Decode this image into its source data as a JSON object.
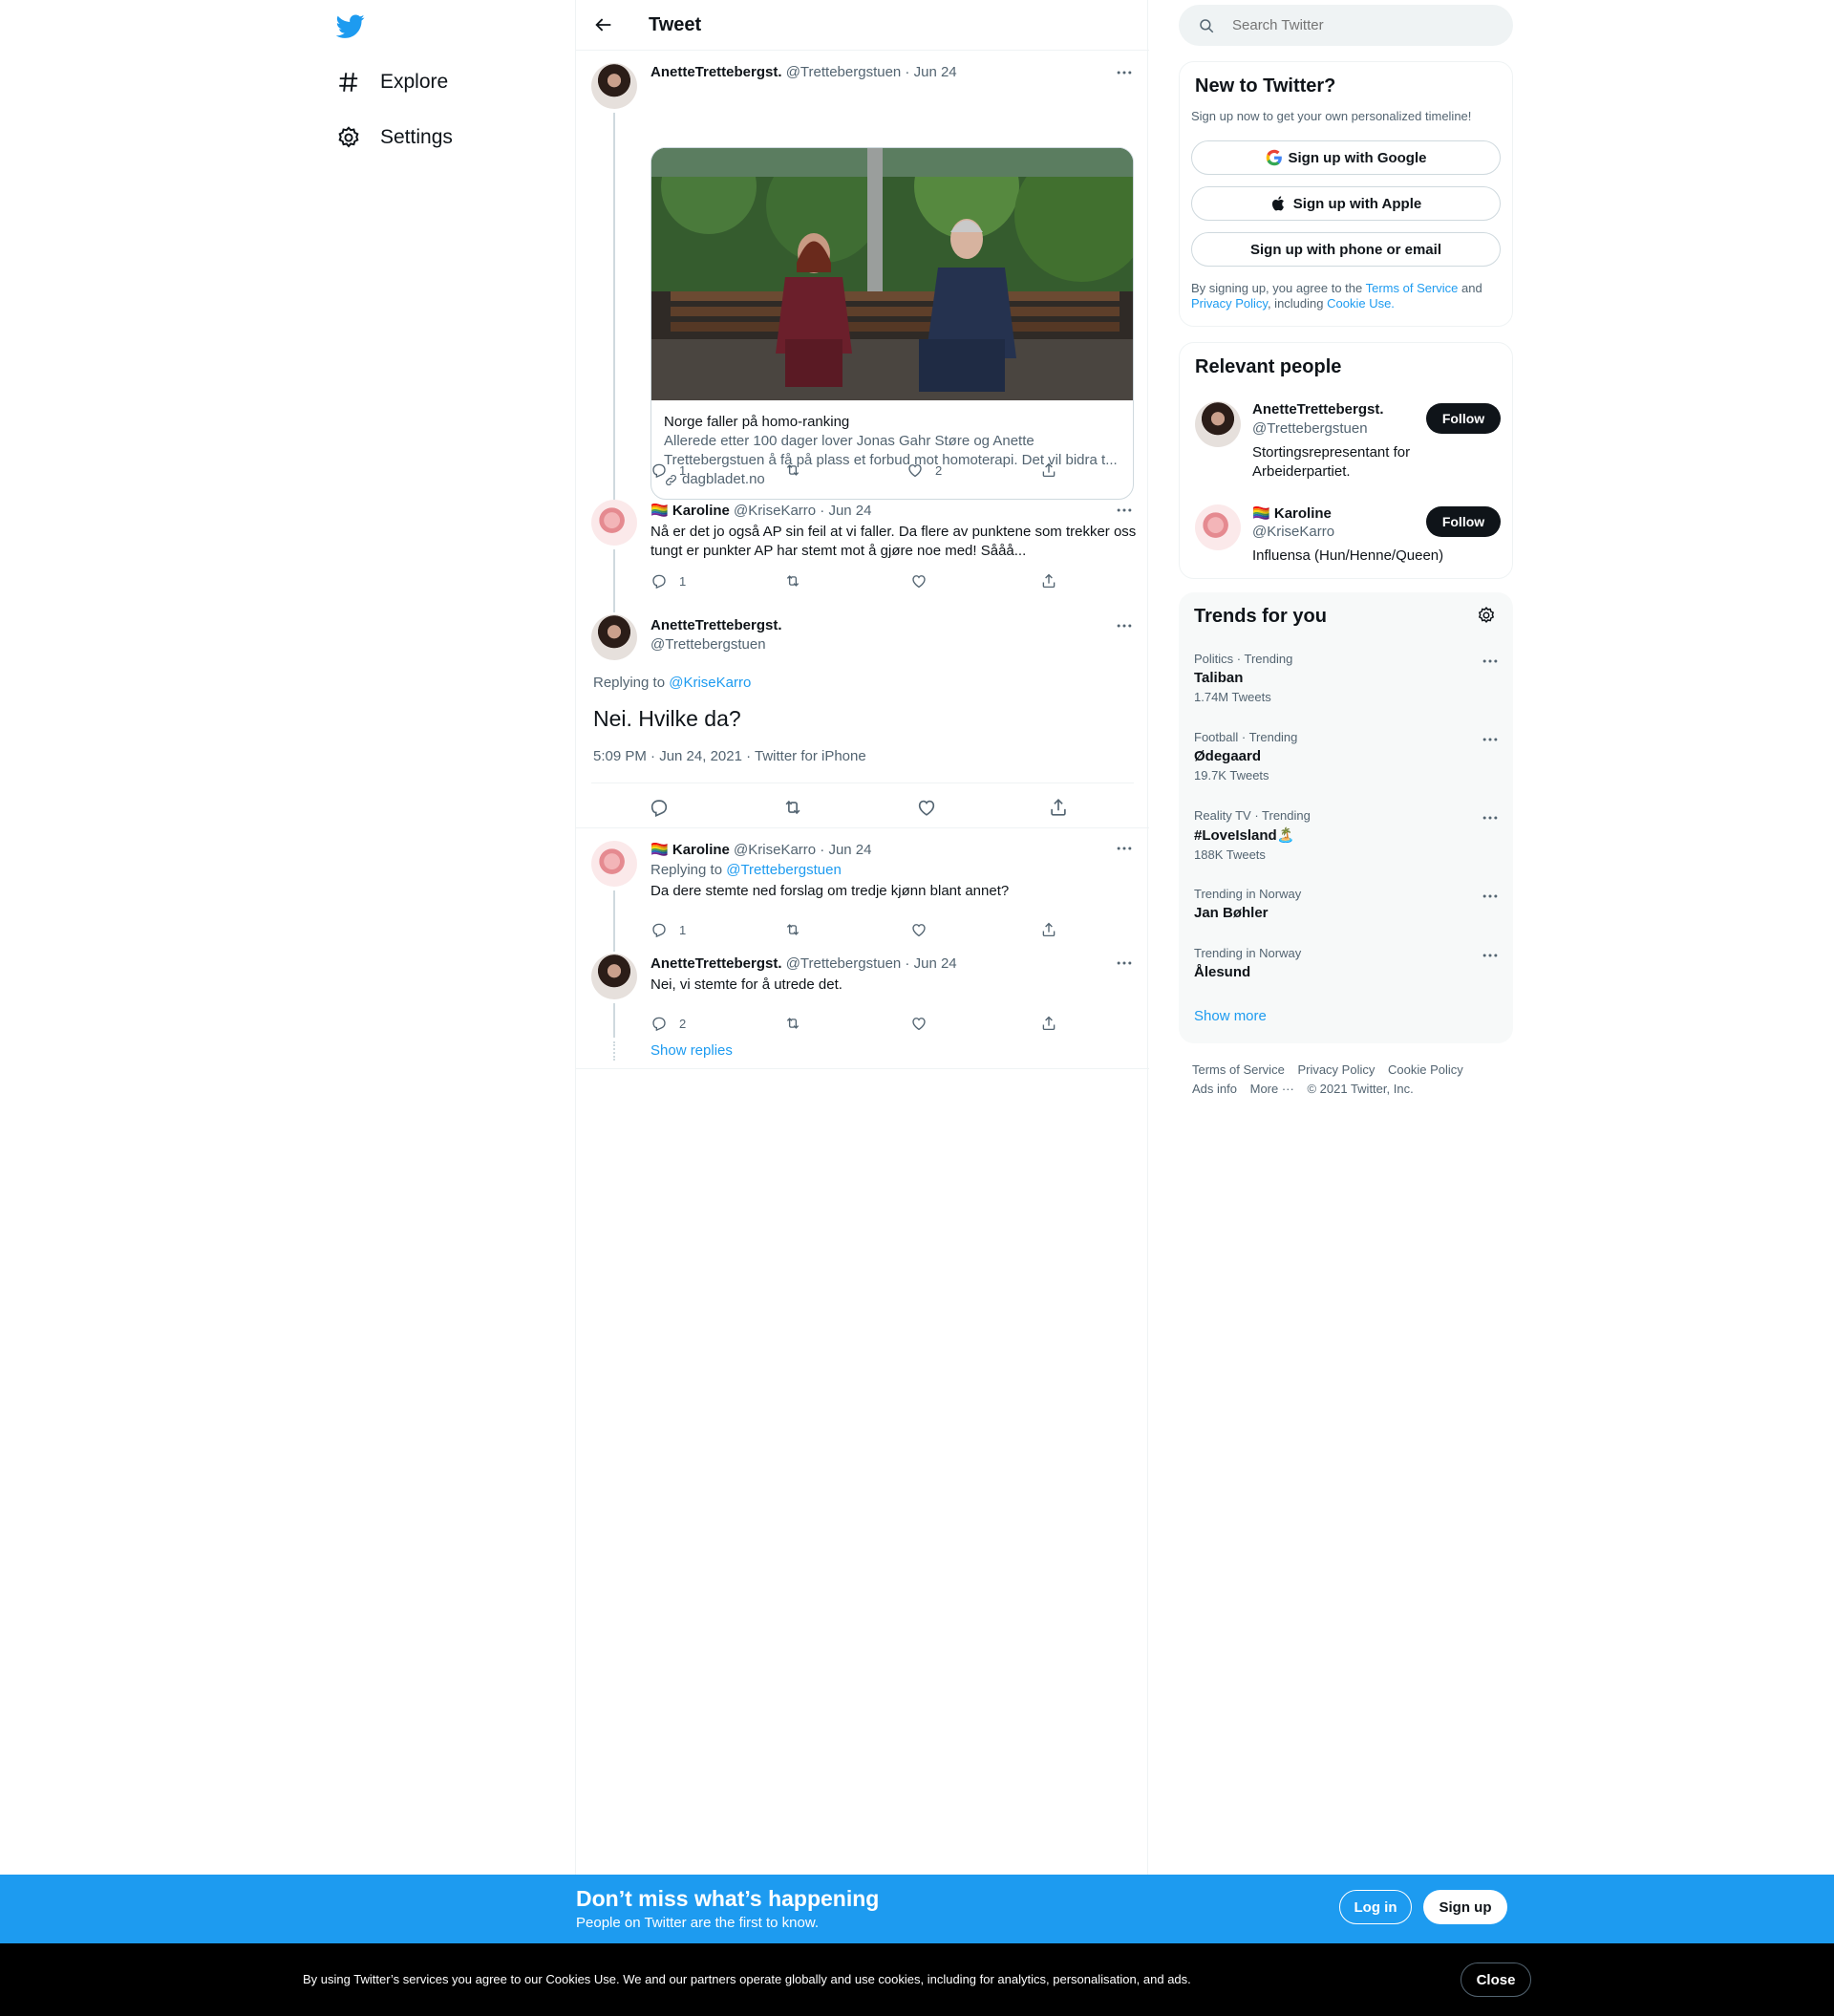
{
  "nav": {
    "explore": "Explore",
    "settings": "Settings"
  },
  "header": {
    "title": "Tweet"
  },
  "tweets": [
    {
      "name": "AnetteTrettebergst.",
      "meta": "@Trettebergstuen · Jun 24",
      "card": {
        "title": "Norge faller på homo-ranking",
        "description": "Allerede etter 100 dager lover Jonas Gahr Støre og Anette Trettebergstuen å få på plass et forbud mot homoterapi. Det vil bidra t...",
        "domain": "dagbladet.no"
      },
      "replies": "1",
      "likes": "2"
    },
    {
      "flag": "🏳️‍🌈",
      "name": "Karoline",
      "meta": "@KriseKarro · Jun 24",
      "text": "Nå er det jo også AP sin feil at vi faller. Da flere av punktene som trekker oss tungt er punkter AP har stemt mot å gjøre noe med! Sååå...",
      "replies": "1"
    }
  ],
  "focus": {
    "name": "AnetteTrettebergst.",
    "handle": "@Trettebergstuen",
    "replying_prefix": "Replying to ",
    "replying_to": "@KriseKarro",
    "text": "Nei. Hvilke da?",
    "meta": "5:09 PM · Jun 24, 2021 · Twitter for iPhone"
  },
  "replies": [
    {
      "flag": "🏳️‍🌈",
      "name": "Karoline",
      "meta": "@KriseKarro · Jun 24",
      "replying_prefix": "Replying to ",
      "replying_to": "@Trettebergstuen",
      "text": "Da dere stemte ned forslag om tredje kjønn blant annet?",
      "replies": "1"
    },
    {
      "name": "AnetteTrettebergst.",
      "meta": "@Trettebergstuen · Jun 24",
      "text": "Nei, vi stemte for å utrede det.",
      "replies": "2"
    }
  ],
  "show_replies": "Show replies",
  "sidebar": {
    "search_placeholder": "Search Twitter",
    "new": {
      "title": "New to Twitter?",
      "subtitle": "Sign up now to get your own personalized timeline!",
      "google": "Sign up with Google",
      "apple": "Sign up with Apple",
      "phone": "Sign up with phone or email",
      "terms_1": "By signing up, you agree to the ",
      "terms_link": "Terms of Service",
      "terms_2": " and ",
      "privacy_link": "Privacy Policy",
      "terms_3": ", including ",
      "cookie_link": "Cookie Use."
    },
    "relevant": {
      "title": "Relevant people",
      "people": [
        {
          "name": "AnetteTrettebergst.",
          "handle": "@Trettebergstuen",
          "bio": "Stortingsrepresentant for Arbeiderpartiet.",
          "follow": "Follow"
        },
        {
          "flag": "🏳️‍🌈",
          "name": "Karoline",
          "handle": "@KriseKarro",
          "bio": "Influensa (Hun/Henne/Queen)",
          "follow": "Follow"
        }
      ]
    },
    "trends": {
      "title": "Trends for you",
      "items": [
        {
          "category": "Politics · Trending",
          "name": "Taliban",
          "count": "1.74M Tweets"
        },
        {
          "category": "Football · Trending",
          "name": "Ødegaard",
          "count": "19.7K Tweets"
        },
        {
          "category": "Reality TV · Trending",
          "name": "#LoveIsland🏝️",
          "count": "188K Tweets"
        },
        {
          "category": "Trending in Norway",
          "name": "Jan Bøhler",
          "count": ""
        },
        {
          "category": "Trending in Norway",
          "name": "Ålesund",
          "count": ""
        }
      ],
      "show_more": "Show more"
    },
    "footer": {
      "tos": "Terms of Service",
      "privacy": "Privacy Policy",
      "cookie": "Cookie Policy",
      "ads": "Ads info",
      "more": "More ···",
      "copyright": "© 2021 Twitter, Inc."
    }
  },
  "banner": {
    "title": "Don’t miss what’s happening",
    "subtitle": "People on Twitter are the first to know.",
    "login": "Log in",
    "signup": "Sign up"
  },
  "cookie": {
    "text": "By using Twitter’s services you agree to our Cookies Use. We and our partners operate globally and use cookies, including for analytics, personalisation, and ads.",
    "close": "Close"
  },
  "colors": {
    "accent": "#1d9bf0",
    "text": "#0f1419",
    "secondary": "#536471",
    "border": "#eff3f4",
    "cookie_bg": "#000000"
  }
}
